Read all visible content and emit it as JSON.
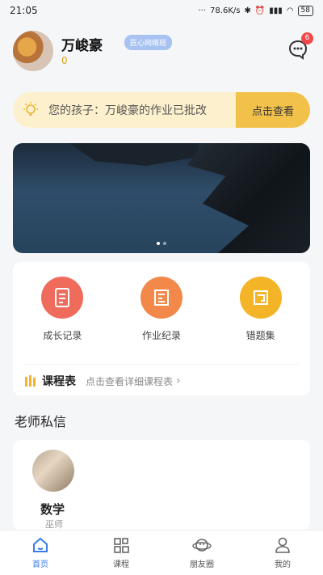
{
  "status": {
    "time": "21:05",
    "speed": "78.6K/s",
    "battery": "58"
  },
  "profile": {
    "name": "万峻豪",
    "class_badge": "匠心网络班",
    "points": "0",
    "msg_count": "6"
  },
  "notice": {
    "text": "您的孩子：万峻豪的作业已批改",
    "button": "点击查看"
  },
  "banner": {
    "dots": 2,
    "active_dot": 1
  },
  "features": [
    {
      "label": "成长记录",
      "icon": "notebook-icon",
      "color": "#ef6b5c"
    },
    {
      "label": "作业纪录",
      "icon": "homework-icon",
      "color": "#f2894a"
    },
    {
      "label": "错题集",
      "icon": "folder-icon",
      "color": "#f4b427"
    }
  ],
  "schedule": {
    "title": "课程表",
    "hint": "点击查看详细课程表"
  },
  "section": {
    "title": "老师私信"
  },
  "teacher": {
    "subject": "数学",
    "name": "巫师"
  },
  "tabs": [
    {
      "label": "首页",
      "icon": "home-icon",
      "active": true
    },
    {
      "label": "课程",
      "icon": "grid-icon",
      "active": false
    },
    {
      "label": "朋友圈",
      "icon": "planet-icon",
      "active": false
    },
    {
      "label": "我的",
      "icon": "user-icon",
      "active": false
    }
  ],
  "colors": {
    "accent": "#3b7de6",
    "notice_bg": "#fdf1cd",
    "notice_btn": "#f2c14a",
    "badge": "#f04848"
  }
}
